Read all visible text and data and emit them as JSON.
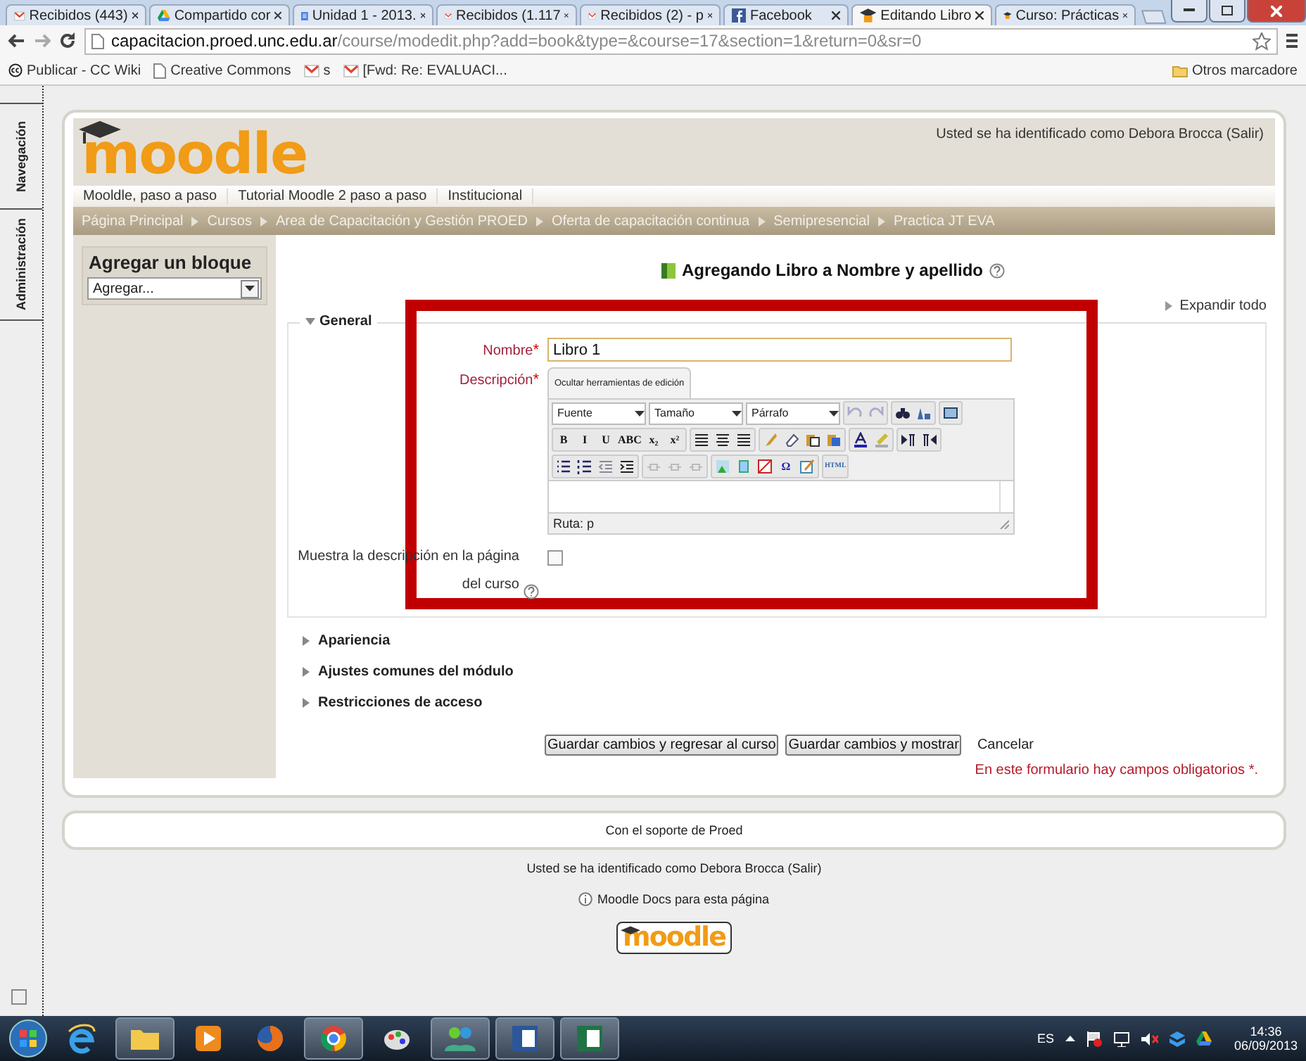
{
  "browser": {
    "tabs": [
      {
        "label": "Recibidos (443)",
        "kind": "mail",
        "selected": false
      },
      {
        "label": "Compartido cor",
        "kind": "drive",
        "selected": false
      },
      {
        "label": "Unidad 1 - 2013.",
        "kind": "docs",
        "selected": false
      },
      {
        "label": "Recibidos (1.117",
        "kind": "mail",
        "selected": false
      },
      {
        "label": "Recibidos (2) - p",
        "kind": "mail",
        "selected": false
      },
      {
        "label": "Facebook",
        "kind": "facebook",
        "selected": false
      },
      {
        "label": "Editando Libro",
        "kind": "moodle",
        "selected": true
      },
      {
        "label": "Curso: Prácticas",
        "kind": "moodle",
        "selected": false
      }
    ],
    "url_host": "capacitacion.proed.unc.edu.ar",
    "url_path": "/course/modedit.php?add=book&type=&course=17&section=1&return=0&sr=0",
    "bookmarks": [
      {
        "label": "Publicar - CC Wiki",
        "kind": "cc"
      },
      {
        "label": "Creative Commons",
        "kind": "page"
      },
      {
        "label": "s",
        "kind": "mail"
      },
      {
        "label": "[Fwd: Re: EVALUACI...",
        "kind": "mail"
      }
    ],
    "other_bookmarks": "Otros marcadore"
  },
  "dock": [
    "Navegación",
    "Administración"
  ],
  "header": {
    "logo": "moodle",
    "login": "Usted se ha identificado como Debora Brocca (Salir)",
    "menu": [
      "Mooldle, paso a paso",
      "Tutorial Moodle 2 paso a paso",
      "Institucional"
    ],
    "breadcrumb": [
      "Página Principal",
      "Cursos",
      "Area de Capacitación y Gestión PROED",
      "Oferta de capacitación continua",
      "Semipresencial",
      "Practica JT EVA"
    ]
  },
  "block": {
    "title": "Agregar un bloque",
    "select": "Agregar..."
  },
  "form": {
    "title": "Agregando Libro a Nombre y apellido",
    "expand_all": "Expandir todo",
    "general": {
      "legend": "General",
      "expanded": true
    },
    "name": {
      "label": "Nombre",
      "mark": "*",
      "value": "Libro 1"
    },
    "description": {
      "label": "Descripción",
      "mark": "*"
    },
    "editor": {
      "toggle": "Ocultar herramientas de edición",
      "selects": [
        "Fuente",
        "Tamaño",
        "Párrafo"
      ],
      "format_buttons": [
        "B",
        "I",
        "U",
        "ABC",
        "x₂",
        "x²"
      ],
      "special_buttons": [
        "Ω",
        "HTML"
      ],
      "path": "Ruta: p"
    },
    "show_description": {
      "label": "Muestra la descripción en la página del curso",
      "checked": false
    },
    "sections": [
      {
        "label": "Apariencia",
        "expanded": false
      },
      {
        "label": "Ajustes comunes del módulo",
        "expanded": false
      },
      {
        "label": "Restricciones de acceso",
        "expanded": false
      }
    ],
    "buttons": [
      "Guardar cambios y regresar al curso",
      "Guardar cambios y mostrar"
    ],
    "cancel": "Cancelar",
    "required_notice": "En este formulario hay campos obligatorios *."
  },
  "footer": {
    "support": "Con el soporte de  Proed",
    "login": "Usted se ha identificado como Debora Brocca (Salir)",
    "docs": "Moodle Docs para esta página",
    "logo": "moodle"
  },
  "taskbar": {
    "language": "ES",
    "time": "14:36",
    "date": "06/09/2013"
  }
}
